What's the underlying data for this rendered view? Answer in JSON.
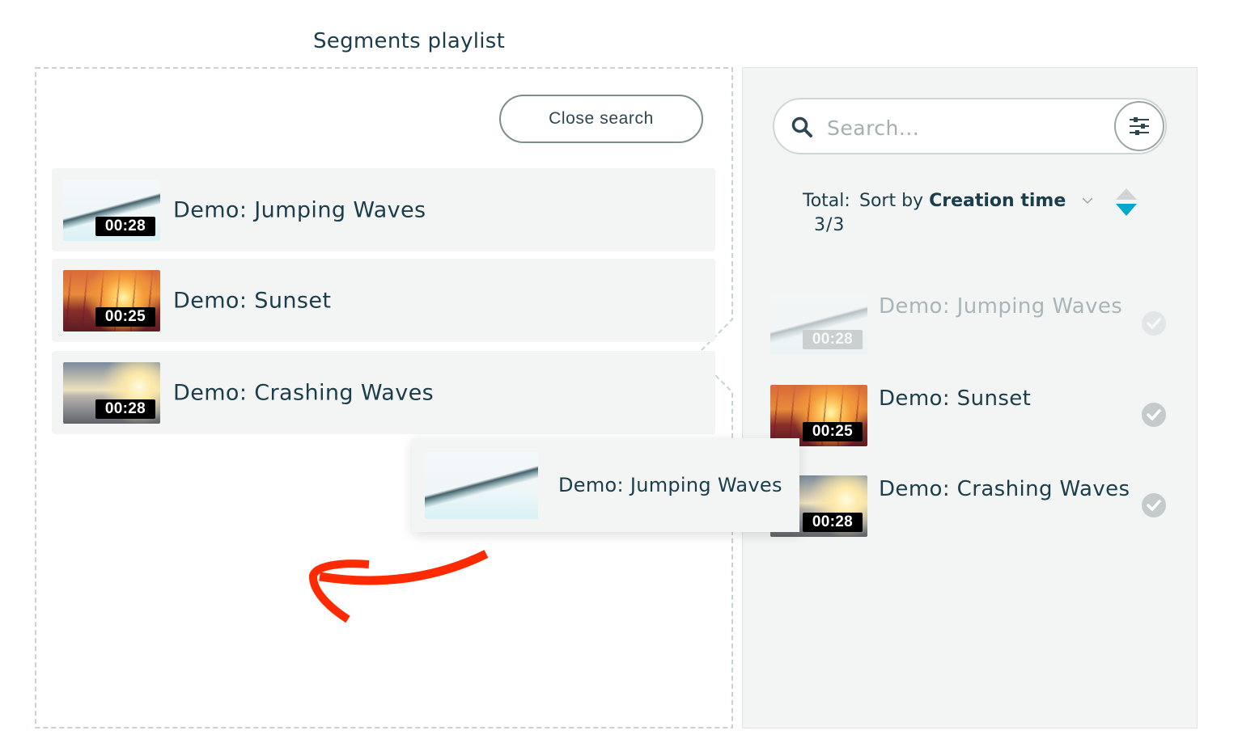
{
  "playlist": {
    "title": "Segments playlist",
    "close_search_label": "Close search",
    "items": [
      {
        "name": "Demo: Jumping Waves",
        "duration": "00:28",
        "thumbnail": "waves"
      },
      {
        "name": "Demo: Sunset",
        "duration": "00:25",
        "thumbnail": "sunset"
      },
      {
        "name": "Demo: Crashing Waves",
        "duration": "00:28",
        "thumbnail": "crashing-waves"
      }
    ]
  },
  "search_panel": {
    "search": {
      "placeholder": "Search...",
      "value": ""
    },
    "filter_icon": "sliders-icon",
    "total_label": "Total:",
    "total_value": "3/3",
    "sort_prefix": "Sort by",
    "sort_field": "Creation time",
    "sort_direction": "descending",
    "results": [
      {
        "name": "Demo: Jumping Waves",
        "duration": "00:28",
        "thumbnail": "waves",
        "added": true,
        "state": "dragging"
      },
      {
        "name": "Demo: Sunset",
        "duration": "00:25",
        "thumbnail": "sunset",
        "added": true
      },
      {
        "name": "Demo: Crashing Waves",
        "duration": "00:28",
        "thumbnail": "crashing-waves",
        "added": true
      }
    ]
  },
  "drag_preview": {
    "name": "Demo: Jumping Waves",
    "thumbnail": "waves"
  },
  "annotation": {
    "type": "arrow",
    "direction": "left",
    "color": "#ff2a00"
  },
  "colors": {
    "text": "#1b3d4a",
    "panel_bg": "#f3f5f5",
    "accent": "#00a8cc",
    "dashed_border": "#c9d1d3"
  }
}
